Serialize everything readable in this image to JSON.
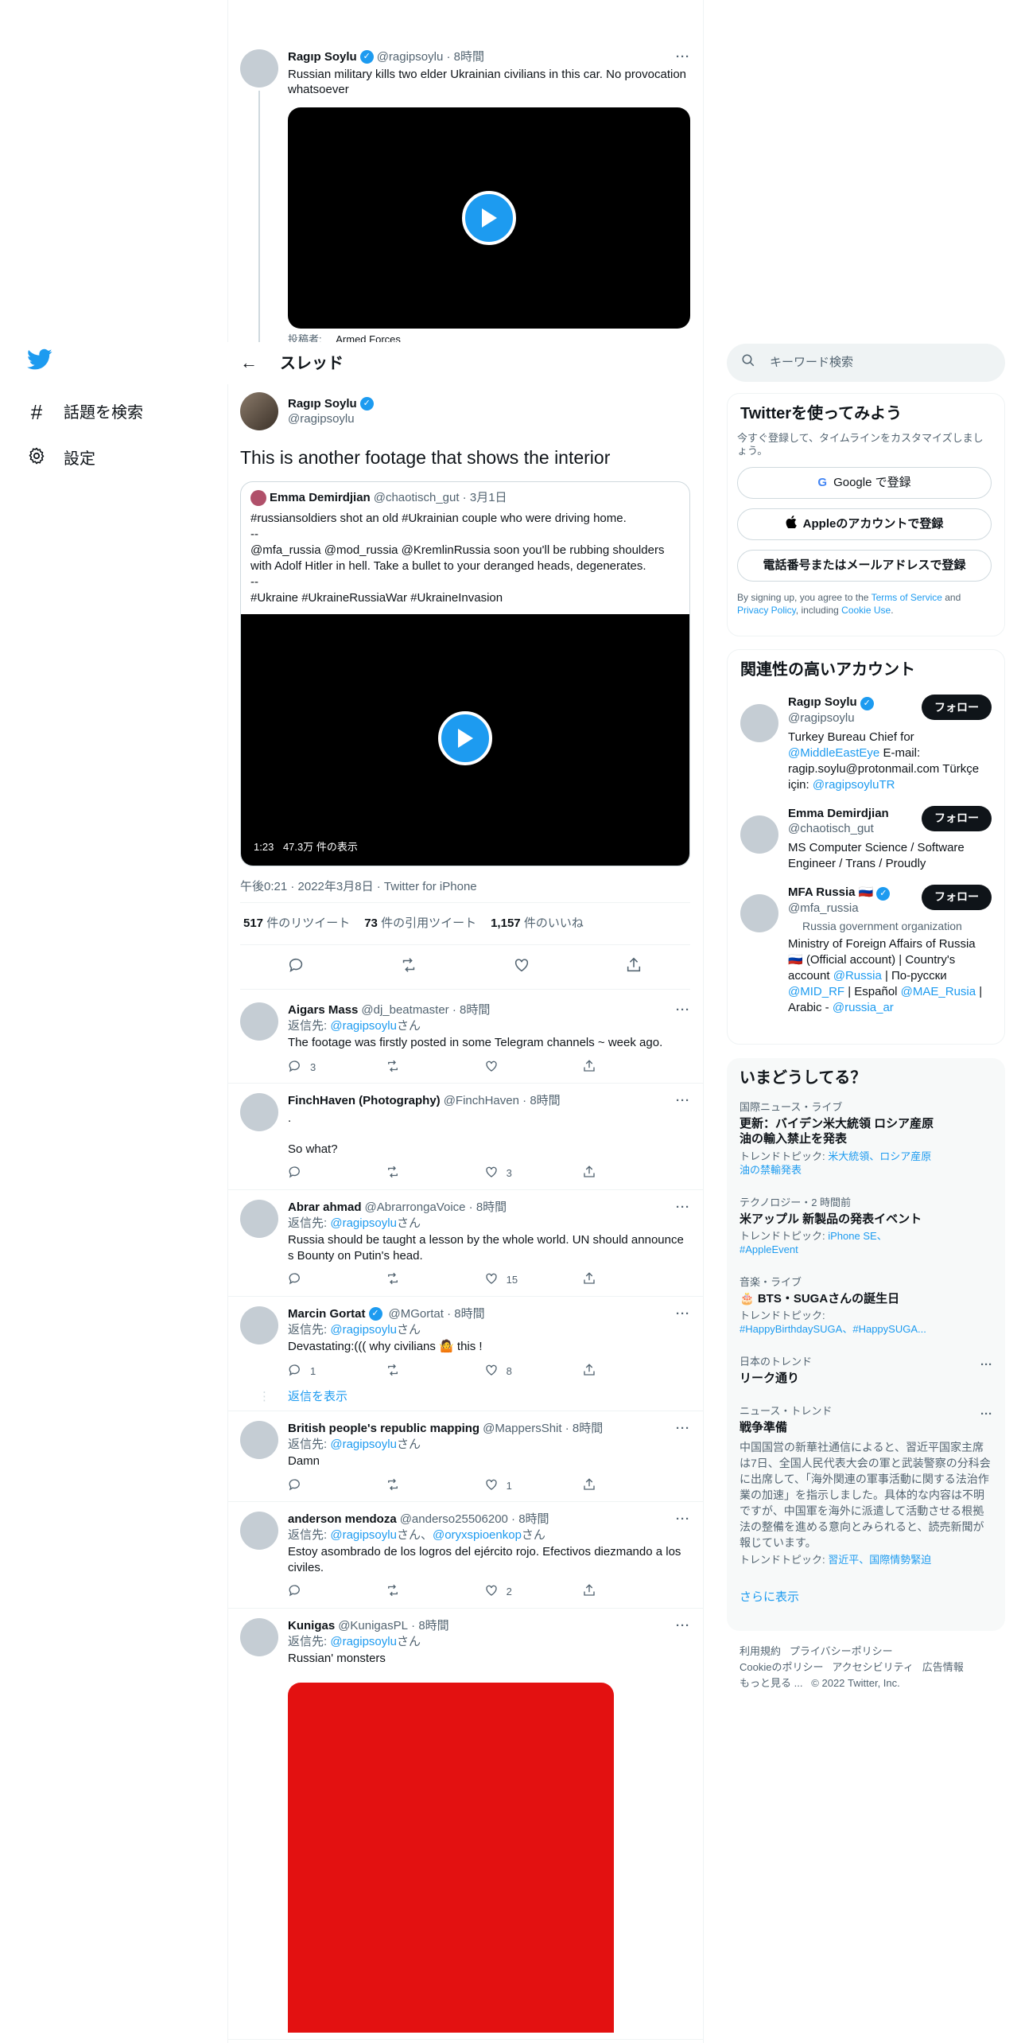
{
  "nav": {
    "topics": "話題を検索",
    "settings": "設定"
  },
  "thread": {
    "title": "スレッド",
    "back_icon": "←"
  },
  "parent": {
    "name": "Ragıp Soylu",
    "handle": "@ragipsoylu",
    "time": "8時間",
    "text": "Russian military kills two elder Ukrainian civilians in this car. No provocation whatsoever",
    "caption_label": "投稿者:",
    "caption_value": "Armed Forces"
  },
  "main": {
    "name": "Ragıp Soylu",
    "handle": "@ragipsoylu",
    "text": "This is another footage that shows the interior",
    "quote": {
      "name": "Emma Demirdjian",
      "handle": "@chaotisch_gut",
      "date": "3月1日",
      "line1": "#russiansoldiers shot an old #Ukrainian couple who were driving home.",
      "line2": "--",
      "line3": "@mfa_russia @mod_russia @KremlinRussia soon you'll be rubbing shoulders with Adolf Hitler in hell. Take a bullet to your deranged heads, degenerates.",
      "line4": "--",
      "line5": "#Ukraine #UkraineRussiaWar #UkraineInvasion",
      "duration": "1:23",
      "views": "47.3万 件の表示"
    },
    "timestamp": "午後0:21 · 2022年3月8日 · Twitter for iPhone",
    "stats": {
      "retweets": "517",
      "retweets_label": "件のリツイート",
      "quotes": "73",
      "quotes_label": "件の引用ツイート",
      "likes": "1,157",
      "likes_label": "件のいいね"
    }
  },
  "replies": [
    {
      "name": "Aigars Mass",
      "handle": "@dj_beatmaster",
      "time": "8時間",
      "reply_to": "返信先:",
      "to": "@ragipsoylu",
      "san": "さん",
      "text": "The footage was firstly posted in some Telegram channels ~ week ago.",
      "reply": "3",
      "rt": "",
      "like": "",
      "verified": false
    },
    {
      "name": "FinchHaven (Photography)",
      "handle": "@FinchHaven",
      "time": "8時間",
      "text": ".\n\nSo what?",
      "reply": "",
      "rt": "",
      "like": "3",
      "verified": false
    },
    {
      "name": "Abrar ahmad",
      "handle": "@AbrarrongaVoice",
      "time": "8時間",
      "reply_to": "返信先:",
      "to": "@ragipsoylu",
      "san": "さん",
      "text": "Russia should be taught a lesson by the whole world. UN should announce s Bounty on Putin's head.",
      "reply": "",
      "rt": "",
      "like": "15",
      "verified": false
    },
    {
      "name": "Marcin Gortat",
      "handle": "@MGortat",
      "time": "8時間",
      "reply_to": "返信先:",
      "to": "@ragipsoylu",
      "san": "さん",
      "text": "Devastating:((( why civilians 🤷 this !",
      "reply": "1",
      "rt": "",
      "like": "8",
      "verified": true,
      "show_replies": "返信を表示"
    },
    {
      "name": "British people's republic mapping",
      "handle": "@MappersShit",
      "time": "8時間",
      "reply_to": "返信先:",
      "to": "@ragipsoylu",
      "san": "さん",
      "text": "Damn",
      "reply": "",
      "rt": "",
      "like": "1",
      "verified": false
    },
    {
      "name": "anderson mendoza",
      "handle": "@anderso25506200",
      "time": "8時間",
      "reply_to": "返信先:",
      "to": "@ragipsoylu",
      "san": "さん、",
      "to2": "@oryxspioenkop",
      "san2": "さん",
      "text": "Estoy asombrado de los logros del ejército rojo. Efectivos diezmando a los civiles.",
      "reply": "",
      "rt": "",
      "like": "2",
      "verified": false
    },
    {
      "name": "Kunigas",
      "handle": "@KunigasPL",
      "time": "8時間",
      "reply_to": "返信先:",
      "to": "@ragipsoylu",
      "san": "さん",
      "text": "Russian' monsters",
      "verified": false
    }
  ],
  "search": {
    "placeholder": "キーワード検索"
  },
  "signup": {
    "title": "Twitterを使ってみよう",
    "subtitle": "今すぐ登録して、タイムラインをカスタマイズしましょう。",
    "google": "Google で登録",
    "apple": "Appleのアカウントで登録",
    "phone": "電話番号またはメールアドレスで登録",
    "legal1": "By signing up, you agree to the ",
    "terms": "Terms of Service",
    "legal2": " and ",
    "privacy": "Privacy Policy",
    "legal3": ", including ",
    "cookie": "Cookie Use",
    "legal4": "."
  },
  "related": {
    "title": "関連性の高いアカウント",
    "follow": "フォロー",
    "accounts": [
      {
        "name": "Ragıp Soylu",
        "handle": "@ragipsoylu",
        "bio1": "Turkey Bureau Chief for ",
        "link1": "@MiddleEastEye",
        "bio2": " E-mail: ragip.soylu@protonmail.com Türkçe için: ",
        "link2": "@ragipsoyluTR"
      },
      {
        "name": "Emma Demirdjian",
        "handle": "@chaotisch_gut",
        "bio1": "MS Computer Science / Software Engineer / Trans / Proudly"
      },
      {
        "name": "MFA Russia 🇷🇺",
        "handle": "@mfa_russia",
        "label": "Russia government organization",
        "bio1": "Ministry of Foreign Affairs of Russia 🇷🇺 (Official account) | Country's account ",
        "link1": "@Russia",
        "bio2": " | По-русски ",
        "link2": "@MID_RF",
        "bio3": " | Español ",
        "link3": "@MAE_Rusia",
        "bio4": " | Arabic - ",
        "link4": "@russia_ar"
      }
    ]
  },
  "trends": {
    "title": "いまどうしてる？",
    "items": [
      {
        "meta": "国際ニュース・ライブ",
        "title": "更新：バイデン米大統領 ロシア産原油の輸入禁止を発表",
        "sub_label": "トレンドトピック: ",
        "sub": "米大統領、ロシア産原油の禁輸発表"
      },
      {
        "meta": "テクノロジー・2 時間前",
        "title": "米アップル 新製品の発表イベント",
        "sub_label": "トレンドトピック: ",
        "sub": "iPhone SE、#AppleEvent"
      },
      {
        "meta": "音楽・ライブ",
        "title": "🎂 BTS・SUGAさんの誕生日",
        "sub_label": "トレンドトピック: ",
        "sub": "#HappyBirthdaySUGA、#HappySUGA..."
      },
      {
        "meta": "日本のトレンド",
        "title": "リーク通り"
      },
      {
        "meta": "ニュース・トレンド",
        "title": "戦争準備",
        "body": "中国国営の新華社通信によると、習近平国家主席は7日、全国人民代表大会の軍と武装警察の分科会に出席して、「海外関連の軍事活動に関する法治作業の加速」を指示しました。具体的な内容は不明ですが、中国軍を海外に派遣して活動させる根拠法の整備を進める意向とみられると、読売新聞が報じています。",
        "sub_label": "トレンドトピック: ",
        "sub": "習近平、国際情勢緊迫"
      }
    ],
    "more": "さらに表示"
  },
  "footer": {
    "l1a": "利用規約",
    "l1b": "プライバシーポリシー",
    "l2a": "Cookieのポリシー",
    "l2b": "アクセシビリティ",
    "l2c": "広告情報",
    "l3a": "もっと見る ...",
    "l3b": "© 2022 Twitter, Inc."
  },
  "colors": {
    "accent": "#1d9bf0",
    "text": "#0f1419",
    "muted": "#536471",
    "red_media": "#e31111"
  }
}
